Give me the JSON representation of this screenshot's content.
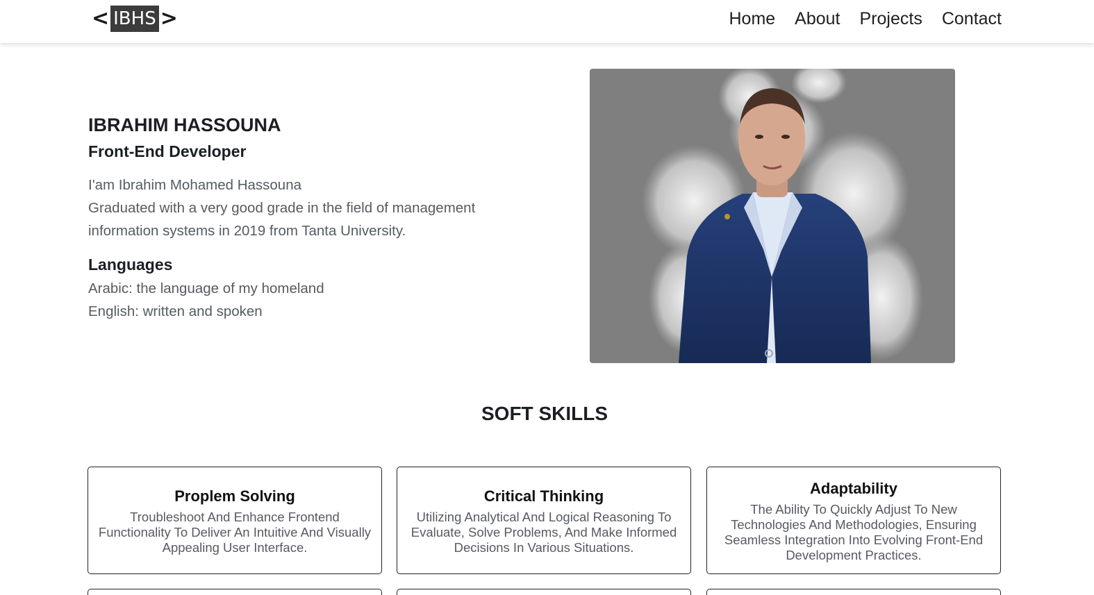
{
  "nav": {
    "logo": {
      "left": "<",
      "box": "IBHS",
      "right": ">"
    },
    "links": [
      "Home",
      "About",
      "Projects",
      "Contact"
    ]
  },
  "hero": {
    "name": "IBRAHIM HASSOUNA",
    "role": "Front-End Developer",
    "intro_line1": "I'am Ibrahim Mohamed Hassouna",
    "intro_line2": "Graduated with a very good grade in the field of management information systems in 2019 from Tanta University.",
    "languages_title": "Languages",
    "languages": [
      "Arabic: the language of my homeland",
      "English: written and spoken"
    ]
  },
  "colors": {
    "portrait_bg": "#7f7f7f",
    "suit": "#1d2f5e",
    "shirt": "#dfe8f5"
  },
  "soft_skills": {
    "title": "SOFT SKILLS",
    "cards": [
      {
        "title": "Proplem Solving",
        "desc": "Troubleshoot And Enhance Frontend Functionality To Deliver An Intuitive And Visually Appealing User Interface."
      },
      {
        "title": "Critical Thinking",
        "desc": "Utilizing Analytical And Logical Reasoning To Evaluate, Solve Problems, And Make Informed Decisions In Various Situations."
      },
      {
        "title": "Adaptability",
        "desc": "The Ability To Quickly Adjust To New Technologies And Methodologies, Ensuring Seamless Integration Into Evolving Front-End Development Practices."
      }
    ]
  }
}
